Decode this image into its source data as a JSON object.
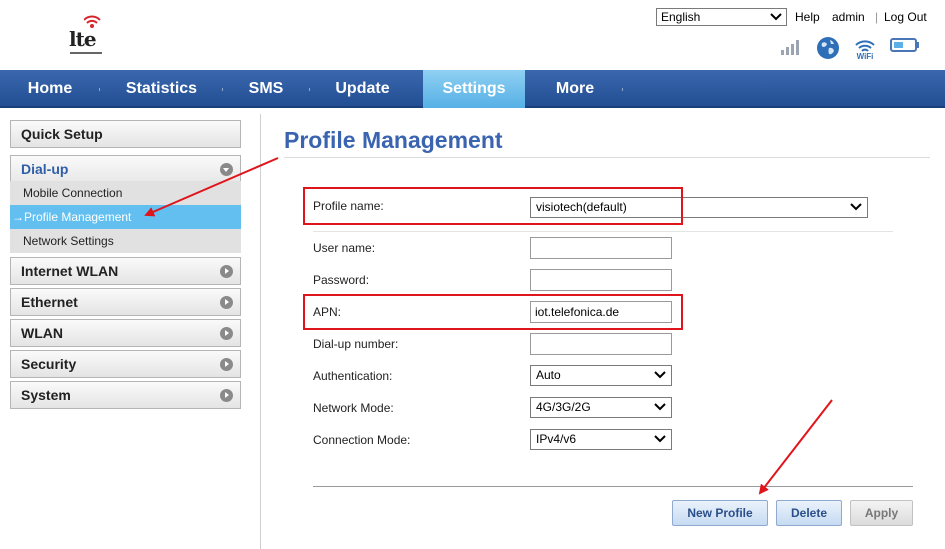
{
  "header": {
    "logo_text": "lte",
    "language": "English",
    "links": {
      "help": "Help",
      "user": "admin",
      "logout": "Log Out"
    }
  },
  "status_icons": [
    "signal-strength-icon",
    "globe-internet-icon",
    "wifi-icon",
    "battery-icon"
  ],
  "nav": {
    "items": [
      "Home",
      "Statistics",
      "SMS",
      "Update",
      "Settings",
      "More"
    ],
    "active": "Settings"
  },
  "sidebar": {
    "quick_setup": "Quick Setup",
    "dialup": {
      "label": "Dial-up",
      "subitems": [
        "Mobile Connection",
        "→Profile Management",
        "Network Settings"
      ]
    },
    "sections": [
      "Internet WLAN",
      "Ethernet",
      "WLAN",
      "Security",
      "System"
    ]
  },
  "main": {
    "title": "Profile Management",
    "fields": {
      "profile_name": {
        "label": "Profile name:",
        "value": "visiotech(default)"
      },
      "user_name": {
        "label": "User name:",
        "value": ""
      },
      "password": {
        "label": "Password:",
        "value": ""
      },
      "apn": {
        "label": "APN:",
        "value": "iot.telefonica.de"
      },
      "dialup_number": {
        "label": "Dial-up number:",
        "value": ""
      },
      "authentication": {
        "label": "Authentication:",
        "value": "Auto"
      },
      "network_mode": {
        "label": "Network Mode:",
        "value": "4G/3G/2G"
      },
      "connection_mode": {
        "label": "Connection Mode:",
        "value": "IPv4/v6"
      }
    },
    "buttons": {
      "new_profile": "New Profile",
      "delete": "Delete",
      "apply": "Apply"
    }
  },
  "colors": {
    "nav_bg": "#2b5aa0",
    "nav_active": "#6cbff0",
    "title": "#3b64b0",
    "annotation": "#e0151b",
    "sidebar_active": "#62bff0"
  }
}
